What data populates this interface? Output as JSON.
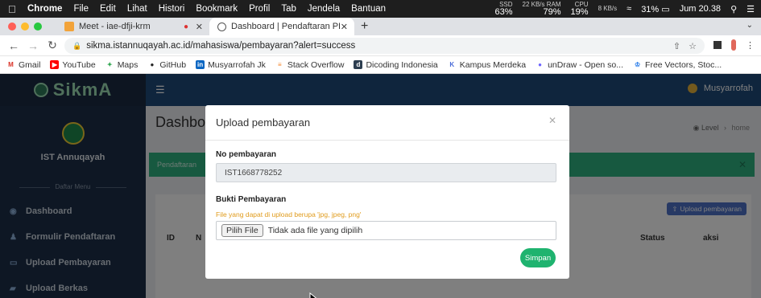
{
  "menubar": {
    "app": "Chrome",
    "items": [
      "File",
      "Edit",
      "Lihat",
      "Histori",
      "Bookmark",
      "Profil",
      "Tab",
      "Jendela",
      "Bantuan"
    ],
    "stats": [
      {
        "small": "SSD",
        "value": "63%"
      },
      {
        "small": "22 KB/s RAM",
        "value": "79%"
      },
      {
        "small": "CPU",
        "value": "19%"
      }
    ],
    "stat_sub": "8 KB/s",
    "battery": "31%",
    "clock": "Jum 20.38"
  },
  "tabs": [
    {
      "title": "Meet - iae-dfji-krm",
      "active": false
    },
    {
      "title": "Dashboard | Pendaftaran PKL",
      "active": true
    }
  ],
  "address": {
    "url": "sikma.istannuqayah.ac.id/mahasiswa/pembayaran?alert=success"
  },
  "bookmarks": [
    {
      "label": "Gmail",
      "color": "#d93025",
      "glyph": "M"
    },
    {
      "label": "YouTube",
      "color": "#ff0000",
      "glyph": "▶"
    },
    {
      "label": "Maps",
      "color": "#34a853",
      "glyph": "✦"
    },
    {
      "label": "GitHub",
      "color": "#222222",
      "glyph": "●"
    },
    {
      "label": "Musyarrofah Jk",
      "color": "#0a66c2",
      "glyph": "in"
    },
    {
      "label": "Stack Overflow",
      "color": "#f48024",
      "glyph": "≡"
    },
    {
      "label": "Dicoding Indonesia",
      "color": "#2d3e50",
      "glyph": "d"
    },
    {
      "label": "Kampus Merdeka",
      "color": "#4a6bd8",
      "glyph": "K"
    },
    {
      "label": "unDraw - Open so...",
      "color": "#6c63ff",
      "glyph": "●"
    },
    {
      "label": "Free Vectors, Stoc...",
      "color": "#1a73e8",
      "glyph": "♔"
    }
  ],
  "sidebar": {
    "brand": "SikmA",
    "institution": "IST Annuqayah",
    "menu_header": "Daftar Menu",
    "items": [
      {
        "label": "Dashboard",
        "icon": "dashboard-icon",
        "glyph": "◉"
      },
      {
        "label": "Formulir Pendaftaran",
        "icon": "user-icon",
        "glyph": "♟"
      },
      {
        "label": "Upload Pembayaran",
        "icon": "card-icon",
        "glyph": "▭"
      },
      {
        "label": "Upload Berkas",
        "icon": "file-icon",
        "glyph": "▰"
      }
    ]
  },
  "topnav": {
    "user": "Musyarrofah"
  },
  "page": {
    "title": "Dashboard",
    "breadcrumb_level": "Level",
    "breadcrumb_home": "home",
    "alert_text": "Pendaftaran",
    "upload_button": "Upload pembayaran",
    "columns": {
      "id": "ID",
      "n": "N",
      "status": "Status",
      "aksi": "aksi"
    }
  },
  "modal": {
    "title": "Upload pembayaran",
    "no_label": "No pembayaran",
    "no_value": "IST1668778252",
    "bukti_label": "Bukti Pembayaran",
    "hint": "File yang dapat di upload berupa 'jpg, jpeg, png'",
    "choose_button": "Pilih File",
    "no_file_text": "Tidak ada file yang dipilih",
    "save_button": "Simpan"
  }
}
